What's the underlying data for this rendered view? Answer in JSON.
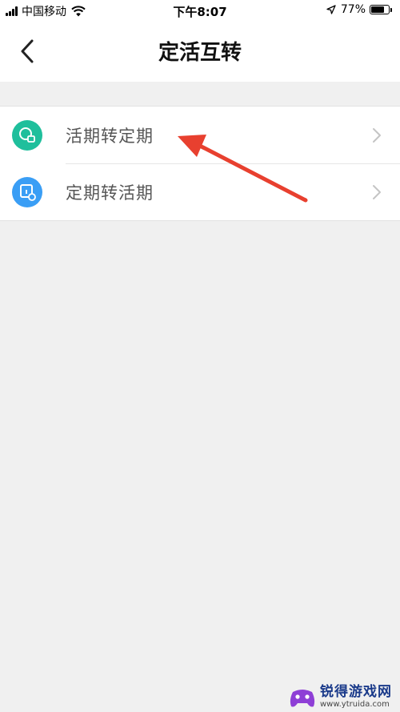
{
  "status_bar": {
    "carrier": "中国移动",
    "time": "下午8:07",
    "battery": "77%",
    "battery_level": 0.77,
    "icons": [
      "signal-icon",
      "wifi-icon",
      "location-arrow-icon",
      "battery-icon"
    ]
  },
  "nav": {
    "title": "定活互转",
    "back_icon": "chevron-left-icon"
  },
  "list": {
    "items": [
      {
        "label": "活期转定期",
        "icon": "current-to-fixed-icon",
        "icon_color": "#1fbf9c"
      },
      {
        "label": "定期转活期",
        "icon": "fixed-to-current-icon",
        "icon_color": "#3a9ef5"
      }
    ],
    "chevron_icon": "chevron-right-icon"
  },
  "annotation": {
    "color": "#e8402f",
    "icon": "red-arrow-annotation"
  },
  "watermark": {
    "title": "锐得游戏网",
    "url": "www.ytruida.com",
    "logo_icon": "gamepad-logo-icon"
  },
  "colors": {
    "background": "#f0f0f0",
    "surface": "#ffffff",
    "title_text": "#111111",
    "label_text": "#555555"
  }
}
